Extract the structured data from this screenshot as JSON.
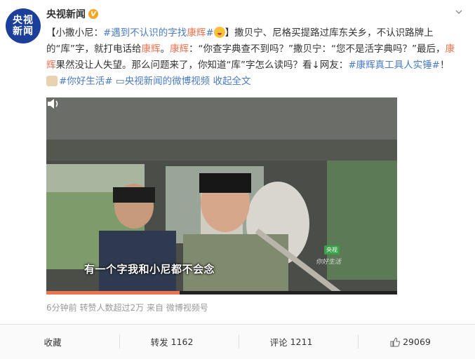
{
  "avatar": {
    "line1": "央视",
    "line2": "新闻"
  },
  "author": {
    "name": "央视新闻",
    "verified_badge": "V"
  },
  "post": {
    "p1": "【小撒小尼：",
    "tag1": "#遇到不认识的字找",
    "tag1_hl": "康辉",
    "tag1_end": "#",
    "p2": "】撒贝宁、尼格买提路过库东关乡，不认识路牌上的“库”字，就打电话给",
    "name1": "康辉",
    "p3": "。",
    "name2": "康辉",
    "p4": "：“你查字典查不到吗？”撒贝宁：“您不是活字典吗？”最后，",
    "name3": "康辉",
    "p5": "果然没让人失望。那么问题来了，你知道“库”字怎么读吗？看↓网友：",
    "tag2": "#康辉真工具人实锤#",
    "p6": "！",
    "tag3": "#你好生活#",
    "video_link": "央视新闻的微博视频",
    "expand": "收起全文",
    "video_link_icon": "video-link-icon"
  },
  "video": {
    "subtitle": "有一个字我和小尼都不会念",
    "badge": "央视",
    "watermark": "你好生活"
  },
  "meta": {
    "time": "6分钟前",
    "reposts_note": "转赞人数超过2万",
    "from_label": "来自",
    "source": "微博视频号"
  },
  "actions": {
    "favorite": "收藏",
    "repost_label": "转发",
    "repost_count": "1162",
    "comment_label": "评论",
    "comment_count": "1211",
    "like_count": "29069"
  },
  "colors": {
    "link": "#eb7350",
    "blue": "#4a7bc2",
    "brand": "#1c3f99",
    "verified": "#f6a623"
  }
}
